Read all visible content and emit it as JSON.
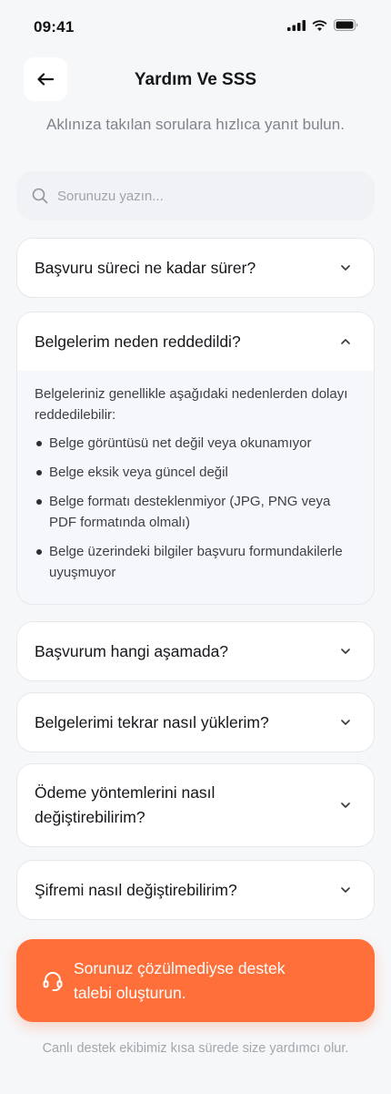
{
  "status_bar": {
    "time": "09:41",
    "icons": [
      "signal-icon",
      "wifi-icon",
      "battery-icon"
    ]
  },
  "header": {
    "back_icon": "arrow-left-icon",
    "title": "Yardım Ve SSS"
  },
  "subtitle": "Aklınıza takılan sorulara hızlıca yanıt bulun.",
  "search": {
    "placeholder": "Sorunuzu yazın...",
    "value": "",
    "icon": "search-icon"
  },
  "faq": [
    {
      "question": "Başvuru süreci ne kadar sürer?",
      "expanded": false
    },
    {
      "question": "Belgelerim neden reddedildi?",
      "expanded": true,
      "answer_intro": "Belgeleriniz genellikle aşağıdaki nedenlerden dolayı reddedilebilir:",
      "answer_points": [
        "Belge görüntüsü net değil veya okunamıyor",
        "Belge eksik veya güncel değil",
        "Belge formatı desteklenmiyor (JPG, PNG veya PDF formatında olmalı)",
        "Belge üzerindeki bilgiler başvuru formundakilerle uyuşmuyor"
      ]
    },
    {
      "question": "Başvurum hangi aşamada?",
      "expanded": false
    },
    {
      "question": "Belgelerimi tekrar nasıl yüklerim?",
      "expanded": false
    },
    {
      "question": "Ödeme yöntemlerini nasıl değiştirebilirim?",
      "expanded": false
    },
    {
      "question": "Şifremi nasıl değiştirebilirim?",
      "expanded": false
    }
  ],
  "cta": {
    "label": "Sorunuz çözülmediyse destek talebi oluşturun.",
    "icon": "headset-icon"
  },
  "footer_note": "Canlı destek ekibimiz kısa sürede size yardımcı olur.",
  "colors": {
    "accent": "#fe6f3a",
    "background": "#f6f7f9"
  }
}
